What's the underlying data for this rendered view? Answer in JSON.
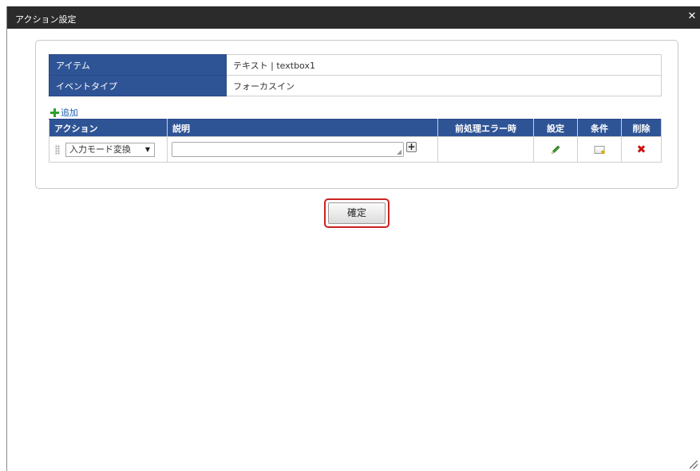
{
  "dialog": {
    "title": "アクション設定",
    "close_icon": "close-icon"
  },
  "info_table": {
    "rows": [
      {
        "header": "アイテム",
        "value": "テキスト | textbox1"
      },
      {
        "header": "イベントタイプ",
        "value": "フォーカスイン"
      }
    ]
  },
  "add_link": {
    "label": "追加",
    "icon": "plus-icon"
  },
  "actions_table": {
    "headers": [
      "アクション",
      "説明",
      "前処理エラー時",
      "設定",
      "条件",
      "削除"
    ],
    "rows": [
      {
        "action": "入力モード変換",
        "description": "",
        "pre_error": "",
        "setting_icon": "pencil-icon",
        "condition_icon": "memo-icon",
        "delete_icon": "x-icon"
      }
    ]
  },
  "confirm_button": {
    "label": "確定"
  },
  "colors": {
    "title_bar": "#2b2b2b",
    "header": "#2f5496",
    "highlight": "#cc2222",
    "add_green": "#2ca02c"
  }
}
